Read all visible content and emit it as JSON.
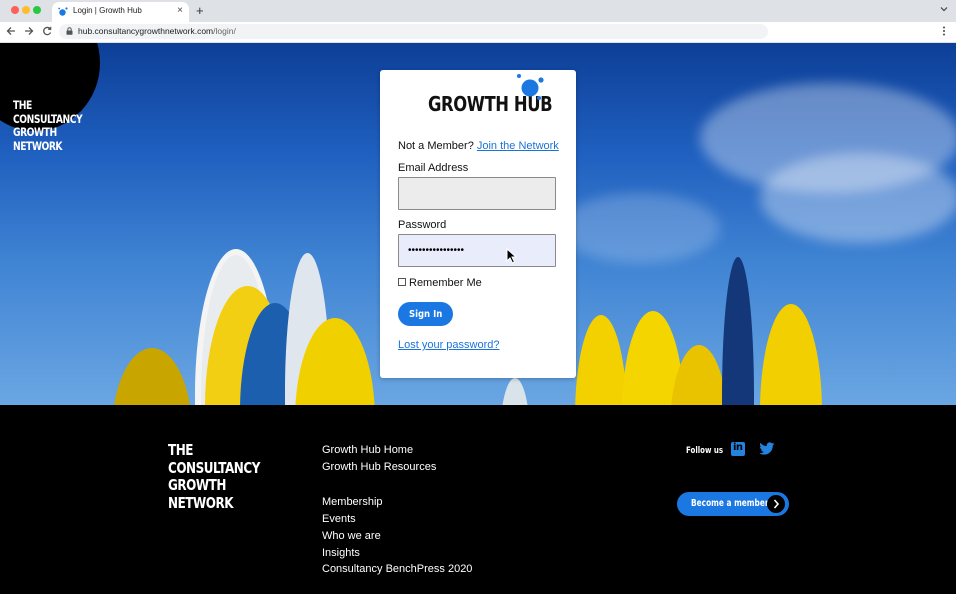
{
  "browser": {
    "tab_title": "Login | Growth Hub",
    "url_host": "hub.consultancygrowthnetwork.com",
    "url_path": "/login/",
    "new_tab_glyph": "+",
    "close_glyph": "×"
  },
  "brand": {
    "badge_text": "THE\nCONSULTANCY\nGROWTH\nNETWORK"
  },
  "login": {
    "logo_text": "GROWTH HUB",
    "member_prompt": "Not a Member?",
    "join_link": "Join the Network",
    "email_label": "Email Address",
    "email_value": "",
    "password_label": "Password",
    "password_value": "••••••••••••••••",
    "remember_label": "Remember Me",
    "remember_checked": false,
    "signin_label": "Sign In",
    "lost_password_link": "Lost your password?"
  },
  "footer": {
    "brand_text": "THE\nCONSULTANCY\nGROWTH\nNETWORK",
    "links_group1": [
      "Growth Hub Home",
      "Growth Hub Resources"
    ],
    "links_group2": [
      "Membership",
      "Events",
      "Who we are",
      "Insights",
      "Consultancy BenchPress 2020"
    ],
    "follow_label": "Follow us",
    "linkedin_glyph": "in",
    "become_member_label": "Become a member"
  },
  "colors": {
    "accent": "#1b78e2",
    "footer_bg": "#000000",
    "link": "#1a73d9"
  },
  "icons": [
    "favicon-icon",
    "close-icon",
    "plus-icon",
    "chevron-down-icon",
    "back-arrow-icon",
    "forward-arrow-icon",
    "reload-icon",
    "lock-icon",
    "kebab-menu-icon",
    "linkedin-icon",
    "twitter-icon",
    "chevron-right-icon",
    "mouse-cursor-icon"
  ]
}
